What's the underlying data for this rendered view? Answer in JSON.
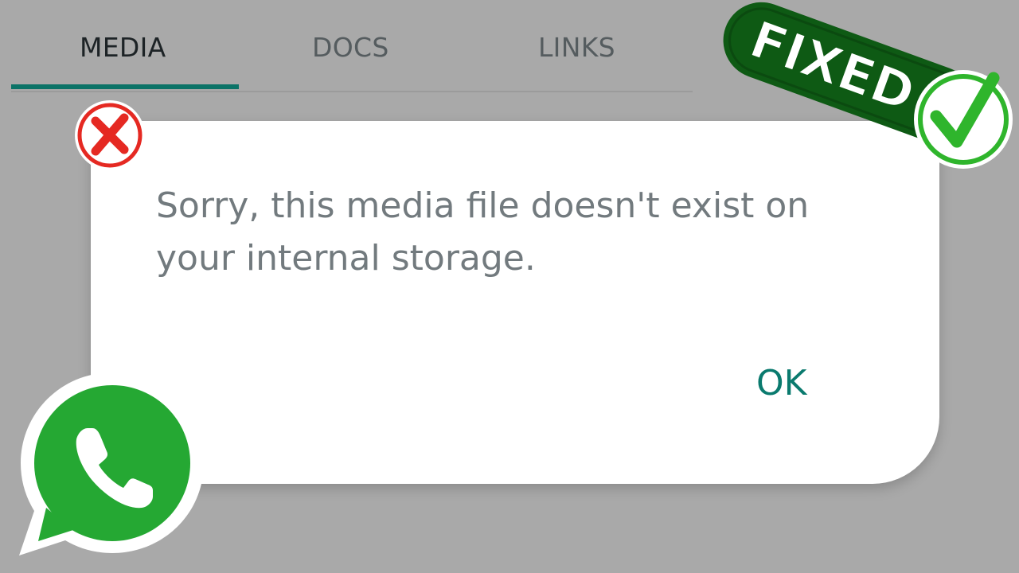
{
  "tabs": [
    {
      "label": "MEDIA",
      "active": true
    },
    {
      "label": "DOCS",
      "active": false
    },
    {
      "label": "LINKS",
      "active": false
    }
  ],
  "dialog": {
    "message": "Sorry, this media file doesn't exist on your internal storage.",
    "ok_label": "OK"
  },
  "badge": {
    "label": "FIXED"
  },
  "icons": {
    "error": "x-mark-icon",
    "check": "check-mark-icon",
    "logo": "whatsapp-logo-icon"
  },
  "colors": {
    "accent": "#0b7367",
    "ok_text": "#0a7a6e",
    "background": "#a9a9a9",
    "badge_green": "#0e5a14",
    "check_green": "#2fb52c",
    "error_red": "#e52922",
    "whatsapp_green": "#25a833"
  }
}
